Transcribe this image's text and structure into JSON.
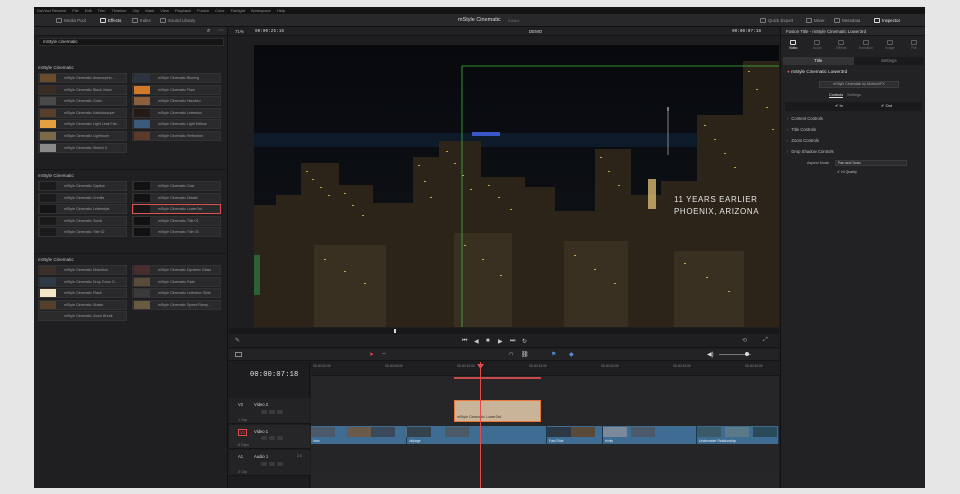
{
  "menubar": [
    "DaVinci Resolve",
    "File",
    "Edit",
    "Trim",
    "Timeline",
    "Clip",
    "Mark",
    "View",
    "Playback",
    "Fusion",
    "Color",
    "Fairlight",
    "Workspace",
    "Help"
  ],
  "toolbar": {
    "media_pool": "Media Pool",
    "effects": "Effects",
    "index": "Index",
    "sound_library": "Sound Library",
    "project_title": "mStyle Cinematic",
    "edited": "Edited",
    "quick_export": "Quick Export",
    "mixer": "Mixer",
    "metadata": "Metadata",
    "inspector": "Inspector"
  },
  "effects": {
    "search_value": "mStyle cinematic",
    "sections": [
      {
        "title": "mStyle Cinematic",
        "items": [
          {
            "label": "mStyle Cinematic Anamorphic...",
            "color": "#6a4a2c"
          },
          {
            "label": "mStyle Cinematic Blurring",
            "color": "#2c3440"
          },
          {
            "label": "mStyle Cinematic Black Vision",
            "color": "#3a2c22"
          },
          {
            "label": "mStyle Cinematic Flare",
            "color": "#d27a2c"
          },
          {
            "label": "mStyle Cinematic Grain",
            "color": "#4a4a4a"
          },
          {
            "label": "mStyle Cinematic Haunted",
            "color": "#8c5e3a"
          },
          {
            "label": "mStyle Cinematic Kaleidoscope",
            "color": "#54402c"
          },
          {
            "label": "mStyle Cinematic Letterbox",
            "color": "#241c14"
          },
          {
            "label": "mStyle Cinematic Light Leak Flat...",
            "color": "#e0a040"
          },
          {
            "label": "mStyle Cinematic Light Diffuse",
            "color": "#3c5a7a"
          },
          {
            "label": "mStyle Cinematic Lightroom",
            "color": "#7c6a4a"
          },
          {
            "label": "mStyle Cinematic Reflection",
            "color": "#5a3a2a"
          },
          {
            "label": "mStyle Cinematic Sketch it",
            "color": "#8a8a8a"
          }
        ]
      },
      {
        "title": "mStyle Cinematic",
        "items": [
          {
            "label": "mStyle Cinematic Caption",
            "color": "#1a1a1a"
          },
          {
            "label": "mStyle Cinematic Cast",
            "color": "#111111"
          },
          {
            "label": "mStyle Cinematic Credits",
            "color": "#1a1a1a"
          },
          {
            "label": "mStyle Cinematic Details",
            "color": "#111111"
          },
          {
            "label": "mStyle Cinematic Letterstyle",
            "color": "#141414"
          },
          {
            "label": "mStyle Cinematic Lower3rd",
            "color": "#161616"
          },
          {
            "label": "mStyle Cinematic Scroll",
            "color": "#1a1a1a"
          },
          {
            "label": "mStyle Cinematic Title 01",
            "color": "#111111"
          },
          {
            "label": "mStyle Cinematic Title 02",
            "color": "#1a1a1a"
          },
          {
            "label": "mStyle Cinematic Title 03",
            "color": "#111111"
          }
        ]
      },
      {
        "title": "mStyle Cinematic",
        "items": [
          {
            "label": "mStyle Cinematic Distortion",
            "color": "#3a3028"
          },
          {
            "label": "mStyle Cinematic Dynamic Glass",
            "color": "#4a2c2c"
          },
          {
            "label": "mStyle Cinematic Drop Zoom O...",
            "color": "#2c3a44"
          },
          {
            "label": "mStyle Cinematic Fade",
            "color": "#5a4a3a"
          },
          {
            "label": "mStyle Cinematic Flash",
            "color": "#f2e6c8"
          },
          {
            "label": "mStyle Cinematic Letterbox Slide",
            "color": "#3a3a3a"
          },
          {
            "label": "mStyle Cinematic Shake",
            "color": "#54402c"
          },
          {
            "label": "mStyle Cinematic Speed Ramp...",
            "color": "#6a5a44"
          },
          {
            "label": "mStyle Cinematic Zoom Break",
            "color": "#2a2a2a"
          }
        ]
      }
    ]
  },
  "viewer": {
    "zoom": "71%",
    "timecode_left": "00:00:25:16",
    "timeline_name": "DEMO",
    "timecode_right": "00:00:07:18",
    "overlay_line1": "11 YEARS EARLIER",
    "overlay_line2": "PHOENIX, ARIZONA"
  },
  "transport": {
    "buttons": [
      "⏮",
      "◀",
      "■",
      "▶",
      "⏭",
      "↻"
    ]
  },
  "inspector": {
    "header": "Fusion Title - mStyle Cinematic Lower3rd",
    "tabs": [
      "Video",
      "Audio",
      "Effects",
      "Transition",
      "Image",
      "File"
    ],
    "segments": [
      "Title",
      "Settings"
    ],
    "title_name": "mStyle Cinematic Lower3rd",
    "sub_button": "mStyle Cinematic by MotionVFX",
    "sub_tabs": [
      "Controls",
      "Settings"
    ],
    "checks": [
      "In",
      "Out"
    ],
    "rows": [
      "Content Controls",
      "Title Controls",
      "Zoom Controls",
      "Drop Shadow Controls"
    ],
    "aspect_label": "Aspect Mode",
    "aspect_value": "Pan and Scan",
    "hq_label": "HI Quality"
  },
  "timeline": {
    "timecode": "00:00:07:18",
    "ruler": [
      "00:00:00:00",
      "00:00:05:00",
      "00:00:10:00",
      "00:00:15:00",
      "00:00:20:00",
      "00:00:25:00",
      "00:00:30:00"
    ],
    "tracks": [
      {
        "id": "V2",
        "name": "Video 2",
        "sub": "1 Clip"
      },
      {
        "id": "V1",
        "name": "Video 1",
        "sub": "8 Clips"
      },
      {
        "id": "A1",
        "name": "Audio 1",
        "sub": "0 Clip",
        "level": "2.0"
      }
    ],
    "title_clip": "mStyle Cinematic Lower3rd",
    "video_clips": [
      "Intro",
      "citylage",
      "Fast Ride",
      "trinity",
      "Underwater Relationship"
    ]
  }
}
